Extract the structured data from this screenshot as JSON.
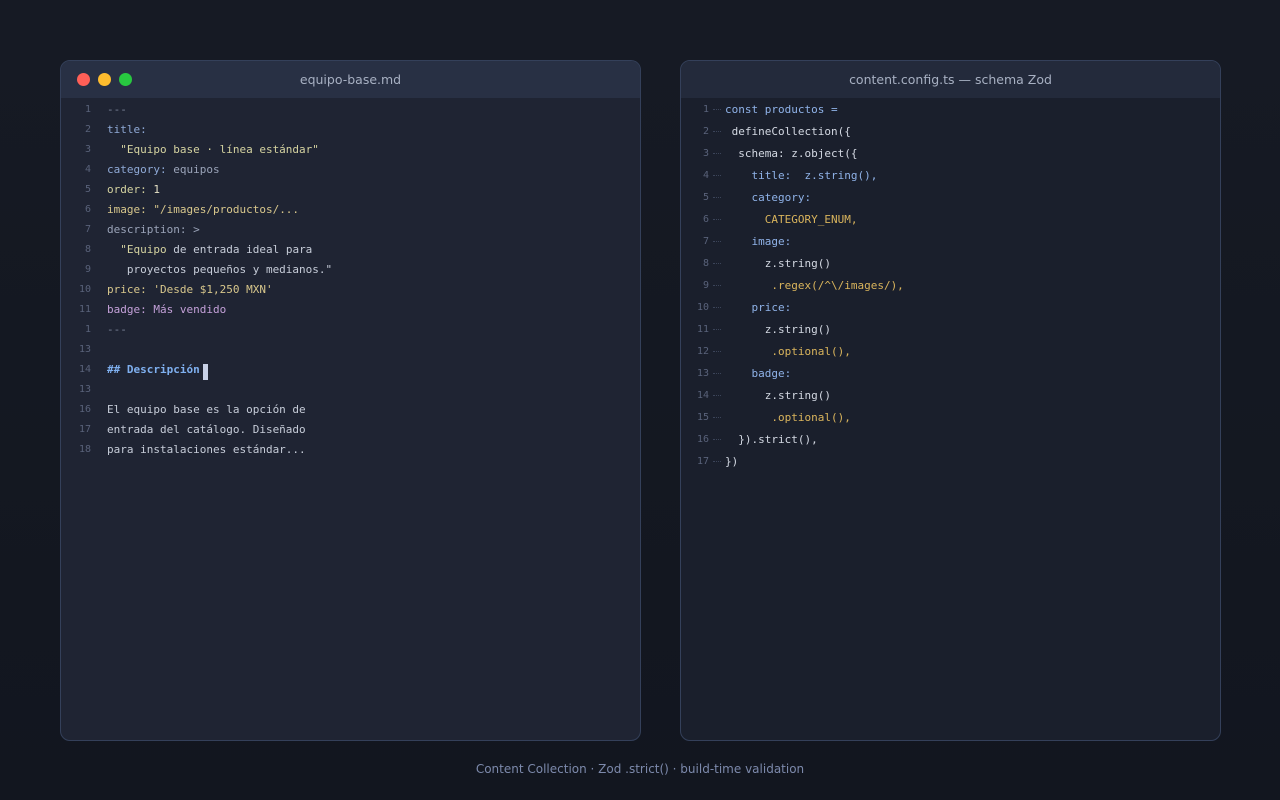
{
  "left_pane": {
    "title": "equipo-base.md",
    "lines": [
      {
        "n": "1",
        "segs": [
          {
            "t": "---",
            "c": "c-dash"
          }
        ]
      },
      {
        "n": "2",
        "segs": [
          {
            "t": "title:",
            "c": "c-key"
          }
        ]
      },
      {
        "n": "3",
        "segs": [
          {
            "t": "  \"Equipo base · línea estándar\"",
            "c": "c-str"
          }
        ]
      },
      {
        "n": "4",
        "segs": [
          {
            "t": "category: ",
            "c": "c-key"
          },
          {
            "t": "equipos",
            "c": "c-val"
          }
        ]
      },
      {
        "n": "5",
        "segs": [
          {
            "t": "order: ",
            "c": "c-str"
          },
          {
            "t": "1",
            "c": "c-num"
          }
        ]
      },
      {
        "n": "6",
        "segs": [
          {
            "t": "image: ",
            "c": "c-yellowkey"
          },
          {
            "t": "\"/images/productos/...",
            "c": "c-yellowkey"
          }
        ]
      },
      {
        "n": "7",
        "segs": [
          {
            "t": "description: >",
            "c": "c-val"
          }
        ]
      },
      {
        "n": "8",
        "segs": [
          {
            "t": "  \"Equipo ",
            "c": "c-str"
          },
          {
            "t": "de entrada ideal para",
            "c": "c-text"
          }
        ]
      },
      {
        "n": "9",
        "segs": [
          {
            "t": "   proyectos pequeños y medianos.\"",
            "c": "c-text"
          }
        ]
      },
      {
        "n": "10",
        "segs": [
          {
            "t": "price: ",
            "c": "c-yellowkey"
          },
          {
            "t": "'Desde $1,250 MXN'",
            "c": "c-yellowkey"
          }
        ]
      },
      {
        "n": "11",
        "segs": [
          {
            "t": "badge: ",
            "c": "c-purple"
          },
          {
            "t": "Más vendido",
            "c": "c-purple"
          }
        ]
      },
      {
        "n": "1",
        "segs": [
          {
            "t": "---",
            "c": "c-dash"
          }
        ]
      },
      {
        "n": "13",
        "segs": []
      },
      {
        "n": "14",
        "segs": [
          {
            "t": "## ",
            "c": "c-heading"
          },
          {
            "t": "Descripción",
            "c": "c-heading"
          }
        ],
        "cursor": true
      },
      {
        "n": "13",
        "segs": []
      },
      {
        "n": "16",
        "segs": [
          {
            "t": "El equipo base es la opción de",
            "c": "c-text"
          }
        ]
      },
      {
        "n": "17",
        "segs": [
          {
            "t": "entrada del catálogo. Diseñado",
            "c": "c-text"
          }
        ]
      },
      {
        "n": "18",
        "segs": [
          {
            "t": "para instalaciones estándar...",
            "c": "c-text"
          }
        ]
      }
    ]
  },
  "right_pane": {
    "title": "content.config.ts — schema Zod",
    "lines": [
      {
        "n": "1",
        "segs": [
          {
            "t": "const productos =",
            "c": "c-blue"
          }
        ]
      },
      {
        "n": "2",
        "segs": [
          {
            "t": " defineCollection({",
            "c": "c-white"
          }
        ]
      },
      {
        "n": "3",
        "segs": [
          {
            "t": "  schema: z.object({",
            "c": "c-white"
          }
        ]
      },
      {
        "n": "4",
        "segs": [
          {
            "t": "    title:  ",
            "c": "c-blue"
          },
          {
            "t": "z.string(),",
            "c": "c-blue"
          }
        ]
      },
      {
        "n": "5",
        "segs": [
          {
            "t": "    category:",
            "c": "c-blue"
          }
        ]
      },
      {
        "n": "6",
        "segs": [
          {
            "t": "      CATEGORY_ENUM,",
            "c": "c-gold"
          }
        ]
      },
      {
        "n": "7",
        "segs": [
          {
            "t": "    image:",
            "c": "c-blue"
          }
        ]
      },
      {
        "n": "8",
        "segs": [
          {
            "t": "      z.string()",
            "c": "c-white"
          }
        ]
      },
      {
        "n": "9",
        "segs": [
          {
            "t": "       .regex(/^\\/images/),",
            "c": "c-gold"
          }
        ]
      },
      {
        "n": "10",
        "segs": [
          {
            "t": "    price:",
            "c": "c-blue"
          }
        ]
      },
      {
        "n": "11",
        "segs": [
          {
            "t": "      z.string()",
            "c": "c-white"
          }
        ]
      },
      {
        "n": "12",
        "segs": [
          {
            "t": "       .optional(),",
            "c": "c-gold"
          }
        ]
      },
      {
        "n": "13",
        "segs": [
          {
            "t": "    badge:",
            "c": "c-blue"
          }
        ]
      },
      {
        "n": "14",
        "segs": [
          {
            "t": "      z.string()",
            "c": "c-white"
          }
        ]
      },
      {
        "n": "15",
        "segs": [
          {
            "t": "       .optional(),",
            "c": "c-gold"
          }
        ]
      },
      {
        "n": "16",
        "segs": [
          {
            "t": "  }).strict(),",
            "c": "c-white"
          }
        ]
      },
      {
        "n": "17",
        "segs": [
          {
            "t": "})",
            "c": "c-white"
          }
        ]
      }
    ]
  },
  "footer": {
    "text": "Content Collection · Zod .strict() · build-time validation"
  }
}
